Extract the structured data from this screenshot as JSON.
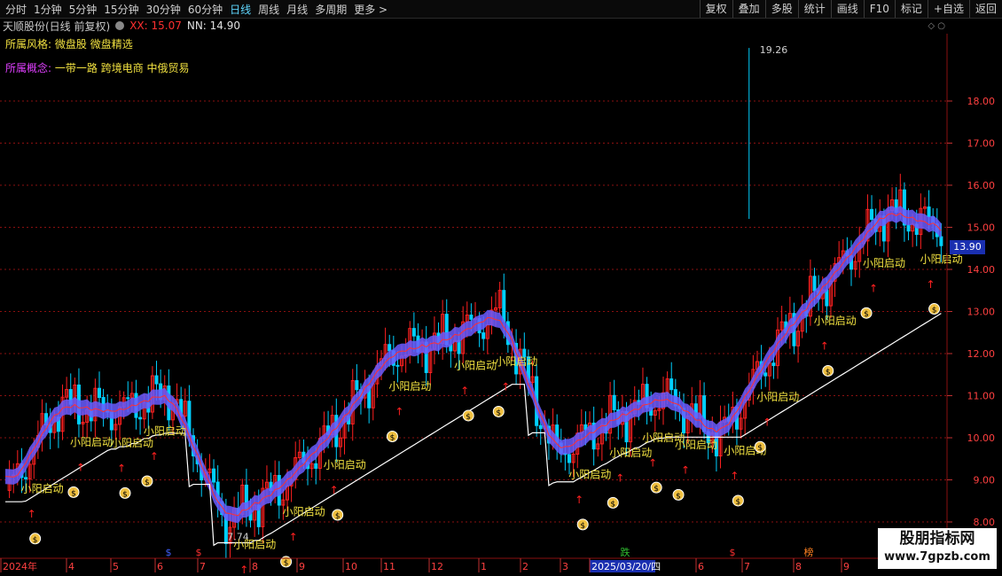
{
  "toolbar": {
    "periods": [
      "分时",
      "1分钟",
      "5分钟",
      "15分钟",
      "30分钟",
      "60分钟",
      "日线",
      "周线",
      "月线",
      "多周期",
      "更多 >"
    ],
    "active_period": "日线",
    "tools": [
      "复权",
      "叠加",
      "多股",
      "统计",
      "画线",
      "F10",
      "标记",
      "+自选",
      "返回"
    ]
  },
  "info": {
    "title": "天顺股份(日线 前复权)",
    "xx_label": "XX: 15.07",
    "nn_label": "NN: 14.90"
  },
  "tags": {
    "style_label": "所属风格:",
    "style_value": "微盘股 微盘精选",
    "concept_label": "所属概念:",
    "concept_value": "一带一路 跨境电商 中俄贸易"
  },
  "price_axis": {
    "ticks": [
      "18.00",
      "17.00",
      "16.00",
      "15.00",
      "14.00",
      "13.00",
      "12.00",
      "11.00",
      "10.00",
      "9.00",
      "8.00"
    ],
    "tick_values": [
      18,
      17,
      16,
      15,
      14,
      13,
      12,
      11,
      10,
      9,
      8
    ],
    "current_price": "13.90",
    "high_label": "19.26",
    "low_label": "7.74"
  },
  "time_axis": {
    "labels": [
      "2024年",
      "4",
      "5",
      "6",
      "7",
      "8",
      "9",
      "10",
      "11",
      "12",
      "1",
      "2",
      "3",
      "2025/03/20/四",
      "6",
      "7",
      "8",
      "9"
    ],
    "bottom_markers": [
      "$",
      "$",
      "跌",
      "$",
      "榜"
    ]
  },
  "signals": {
    "label": "小阳启动",
    "arrow": "↑",
    "bag": "$"
  },
  "watermark": {
    "line1": "股朋指标网",
    "line2": "www.7gpzb.com"
  },
  "colors": {
    "up": "#ff2020",
    "down": "#00d0ff",
    "ribbon": "#6a5cff",
    "trail": "#ffffff",
    "signal_text": "#f0e040",
    "grid": "#8a1010"
  },
  "chart_data": {
    "type": "line",
    "title": "",
    "xlabel": "",
    "ylabel": "",
    "ylim": [
      7.2,
      19.6
    ],
    "x": [
      "2024-03",
      "2024-04",
      "2024-05",
      "2024-06",
      "2024-07",
      "2024-08",
      "2024-09",
      "2024-10",
      "2024-11",
      "2024-12",
      "2025-01",
      "2025-02",
      "2025-03",
      "2025-04",
      "2025-06",
      "2025-07",
      "2025-08",
      "2025-09"
    ],
    "series": [
      {
        "values": [
          8.6,
          10.8,
          10.6,
          11.1,
          8.0,
          8.8,
          10.2,
          12.0,
          12.3,
          13.0,
          9.6,
          10.4,
          11.0,
          10.0,
          12.2,
          13.8,
          15.4,
          15.0
        ]
      }
    ],
    "annotations": [
      "19.26",
      "7.74"
    ]
  }
}
